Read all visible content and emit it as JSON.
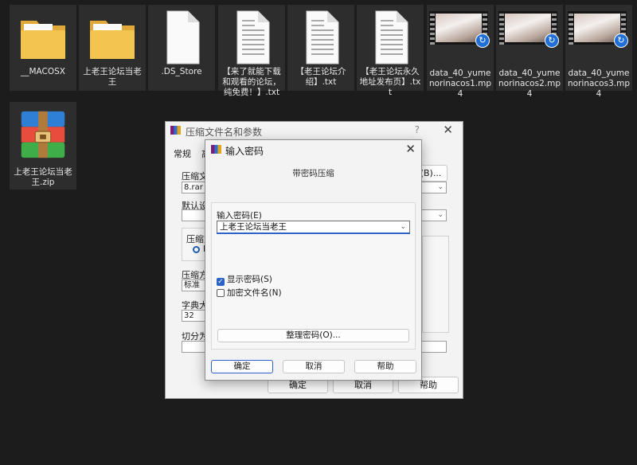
{
  "desktop": {
    "files": [
      {
        "label": "__MACOSX",
        "icon": "folder-icon"
      },
      {
        "label": "上老王论坛当老王",
        "icon": "folder-icon"
      },
      {
        "label": ".DS_Store",
        "icon": "blank-file-icon"
      },
      {
        "label": "【来了就能下载和观看的论坛，纯免费！】.txt",
        "icon": "text-file-icon"
      },
      {
        "label": "【老王论坛介绍】.txt",
        "icon": "text-file-icon"
      },
      {
        "label": "【老王论坛永久地址发布页】.txt",
        "icon": "text-file-icon"
      },
      {
        "label": "data_40_yumenorinacos1.mp4",
        "icon": "video-thumbnail"
      },
      {
        "label": "data_40_yumenorinacos2.mp4",
        "icon": "video-thumbnail"
      },
      {
        "label": "data_40_yumenorinacos3.mp4",
        "icon": "video-thumbnail"
      },
      {
        "label": "上老王论坛当老王.zip",
        "icon": "winrar-archive-icon"
      }
    ]
  },
  "archive_dialog": {
    "title": "压缩文件名和参数",
    "help": "?",
    "close": "✕",
    "tab_general": "常规",
    "tab_partial": "高",
    "archive_name_label": "压缩文",
    "browse_button": "(B)...",
    "archive_name_value": "8.rar",
    "default_profile_label": "默认设",
    "archive_format_label": "压缩文",
    "archive_format_option": "R",
    "compression_method_label": "压缩方",
    "compression_method_value": "标准",
    "dictionary_size_label": "字典大",
    "dictionary_size_value": "32",
    "split_label": "切分为",
    "ok_button": "确定",
    "cancel_button": "取消",
    "help_button": "帮助"
  },
  "password_dialog": {
    "title": "输入密码",
    "close": "✕",
    "heading": "带密码压缩",
    "password_label": "输入密码(E)",
    "password_value": "上老王论坛当老王",
    "show_password_label": "显示密码(S)",
    "show_password_checked": true,
    "encrypt_filenames_label": "加密文件名(N)",
    "encrypt_filenames_checked": false,
    "organize_button": "整理密码(O)...",
    "ok_button": "确定",
    "cancel_button": "取消",
    "help_button": "帮助"
  },
  "colors": {
    "desktop_bg": "#1c1c1c",
    "tile_bg": "#2d2d2d",
    "accent": "#2c63c8",
    "folder_yellow": "#f3c44f"
  }
}
